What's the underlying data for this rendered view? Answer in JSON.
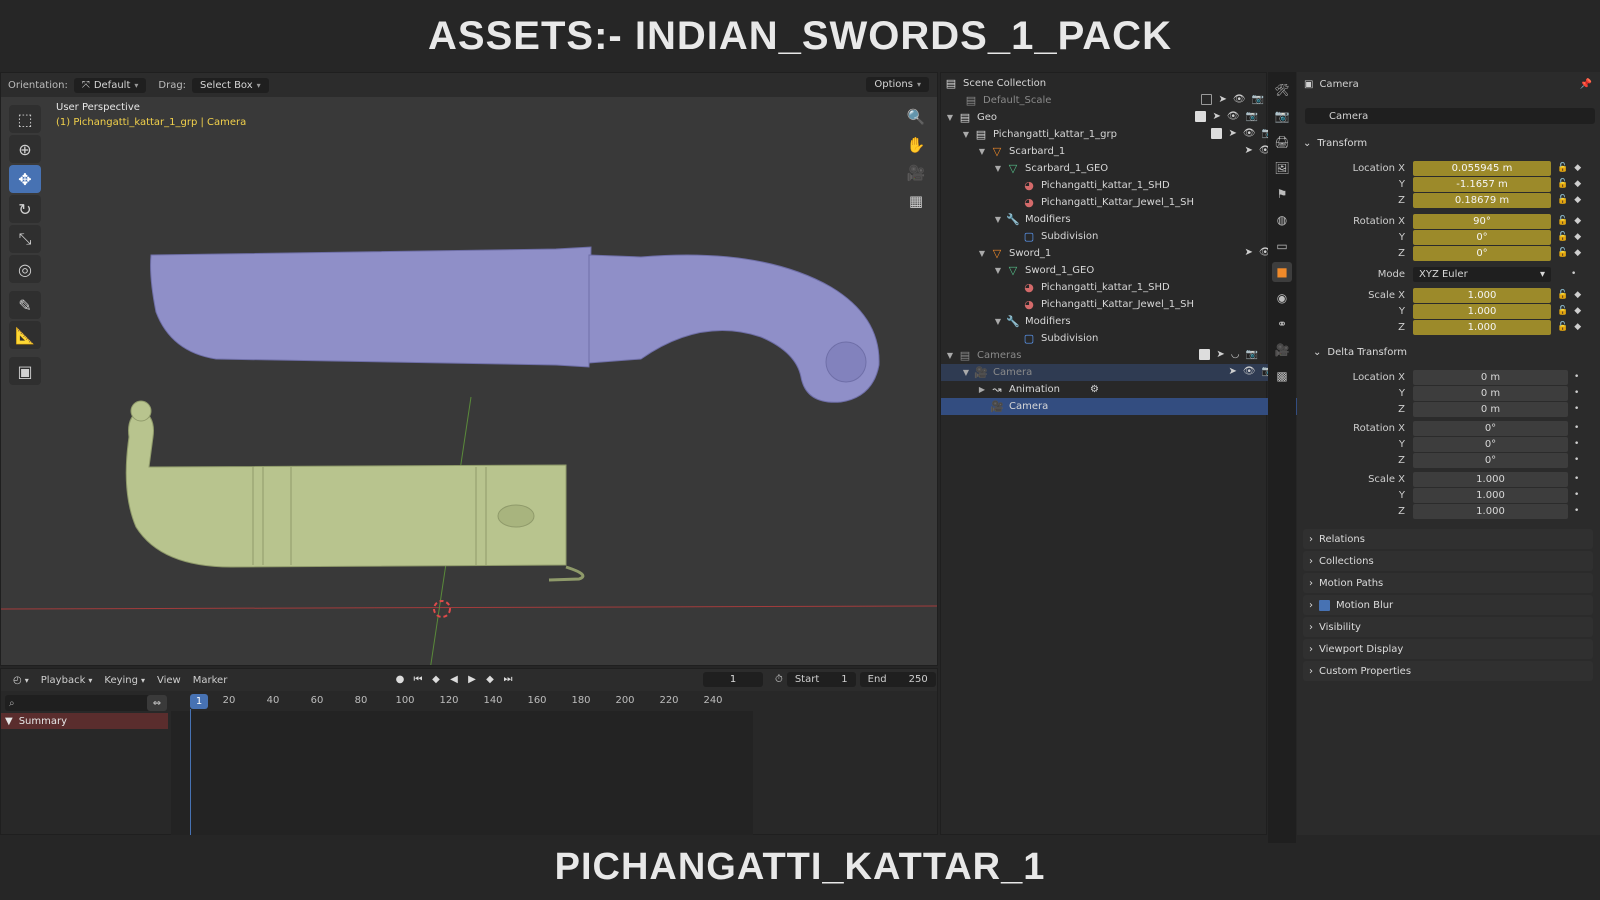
{
  "banner": {
    "title": "ASSETS:- INDIAN_SWORDS_1_PACK",
    "subtitle": "PICHANGATTI_KATTAR_1"
  },
  "viewport": {
    "header": {
      "orientation_label": "Orientation:",
      "orientation_value": "Default",
      "drag_label": "Drag:",
      "drag_value": "Select Box",
      "options_label": "Options"
    },
    "overlay_title": "User Perspective",
    "overlay_object": "(1) Pichangatti_kattar_1_grp | Camera",
    "colors": {
      "blade": "#8f8fc8",
      "scabbard": "#b8c48e",
      "x_axis": "#a33c3c",
      "y_axis": "#5a8a3a"
    }
  },
  "timeline": {
    "menus": [
      "Playback",
      "Keying",
      "View",
      "Marker"
    ],
    "current_frame": "1",
    "start_label": "Start",
    "start_value": "1",
    "end_label": "End",
    "end_value": "250",
    "ruler_current": "1",
    "ruler_ticks": [
      "20",
      "40",
      "60",
      "80",
      "100",
      "120",
      "140",
      "160",
      "180",
      "200",
      "220",
      "240"
    ],
    "summary_label": "Summary"
  },
  "outliner": {
    "rows": [
      {
        "label": "Scene Collection"
      },
      {
        "label": "Default_Scale"
      },
      {
        "label": "Geo"
      },
      {
        "label": "Pichangatti_kattar_1_grp"
      },
      {
        "label": "Scarbard_1"
      },
      {
        "label": "Scarbard_1_GEO"
      },
      {
        "label": "Pichangatti_kattar_1_SHD"
      },
      {
        "label": "Pichangatti_Kattar_Jewel_1_SH"
      },
      {
        "label": "Modifiers"
      },
      {
        "label": "Subdivision"
      },
      {
        "label": "Sword_1"
      },
      {
        "label": "Sword_1_GEO"
      },
      {
        "label": "Pichangatti_kattar_1_SHD"
      },
      {
        "label": "Pichangatti_Kattar_Jewel_1_SH"
      },
      {
        "label": "Modifiers"
      },
      {
        "label": "Subdivision"
      },
      {
        "label": "Cameras"
      },
      {
        "label": "Camera"
      },
      {
        "label": "Animation"
      },
      {
        "label": "Camera"
      }
    ]
  },
  "properties": {
    "header_title": "Camera",
    "object_name": "Camera",
    "transform": {
      "title": "Transform",
      "location_label": "Location X",
      "loc_x": "0.055945 m",
      "loc_y": "-1.1657 m",
      "loc_z": "0.18679 m",
      "rotation_label": "Rotation X",
      "rot_x": "90°",
      "rot_y": "0°",
      "rot_z": "0°",
      "mode_label": "Mode",
      "mode_value": "XYZ Euler",
      "scale_label": "Scale X",
      "scale_x": "1.000",
      "scale_y": "1.000",
      "scale_z": "1.000",
      "y_label": "Y",
      "z_label": "Z"
    },
    "delta": {
      "title": "Delta Transform",
      "location_label": "Location X",
      "loc_x": "0 m",
      "loc_y": "0 m",
      "loc_z": "0 m",
      "rotation_label": "Rotation X",
      "rot_x": "0°",
      "rot_y": "0°",
      "rot_z": "0°",
      "scale_label": "Scale X",
      "scale_x": "1.000",
      "scale_y": "1.000",
      "scale_z": "1.000"
    },
    "collapsed_sections": [
      "Relations",
      "Collections",
      "Motion Paths",
      "Motion Blur",
      "Visibility",
      "Viewport Display",
      "Custom Properties"
    ]
  }
}
